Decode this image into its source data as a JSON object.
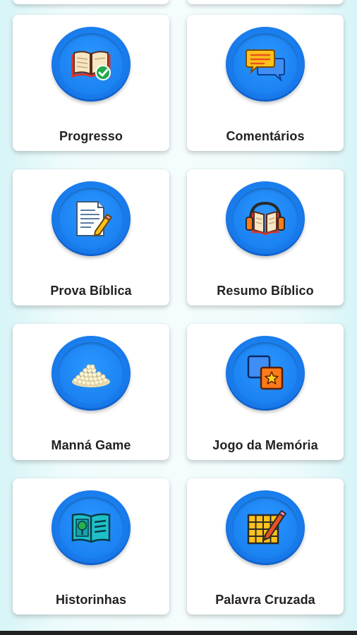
{
  "menu": {
    "items": [
      {
        "label": "Progresso",
        "icon": "book-check-icon"
      },
      {
        "label": "Comentários",
        "icon": "chat-bubbles-icon"
      },
      {
        "label": "Prova Bíblica",
        "icon": "quiz-paper-icon"
      },
      {
        "label": "Resumo Bíblico",
        "icon": "audiobook-icon"
      },
      {
        "label": "Manná Game",
        "icon": "manna-pile-icon"
      },
      {
        "label": "Jogo da Memória",
        "icon": "memory-cards-icon"
      },
      {
        "label": "Historinhas",
        "icon": "storybook-icon"
      },
      {
        "label": "Palavra Cruzada",
        "icon": "crossword-icon"
      }
    ]
  },
  "colors": {
    "badge_blue": "#1a7eee",
    "card_bg": "#ffffff",
    "label_text": "#222222",
    "page_bg": "#eefbfc"
  }
}
